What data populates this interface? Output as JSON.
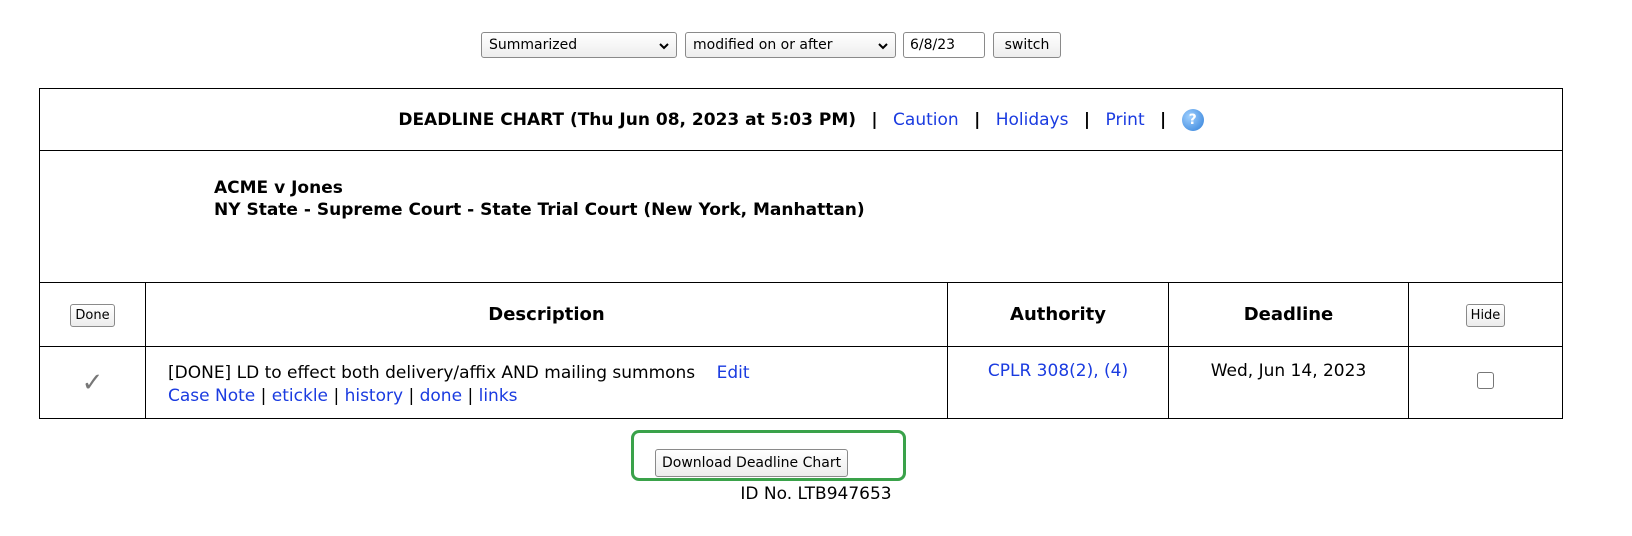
{
  "controls": {
    "view_select": "Summarized",
    "filter_select": "modified on or after",
    "date_value": "6/8/23",
    "switch_label": "switch"
  },
  "header": {
    "title": "DEADLINE CHART (Thu Jun 08, 2023 at 5:03 PM)",
    "caution": "Caution",
    "holidays": "Holidays",
    "print": "Print",
    "separator": "|",
    "help_icon": "?"
  },
  "case": {
    "name": "ACME v Jones",
    "court": "NY State - Supreme Court - State Trial Court (New York, Manhattan)"
  },
  "columns": {
    "done_button": "Done",
    "description": "Description",
    "authority": "Authority",
    "deadline": "Deadline",
    "hide_button": "Hide"
  },
  "rows": [
    {
      "done_mark": "✓",
      "description": "[DONE] LD to effect both delivery/affix AND mailing summons",
      "edit": "Edit",
      "links": {
        "case_note": "Case Note",
        "etickle": "etickle",
        "history": "history",
        "done": "done",
        "links": "links"
      },
      "authority": "CPLR 308(2), (4)",
      "deadline": "Wed, Jun 14, 2023",
      "hidden": false
    }
  ],
  "footer": {
    "download_label": "Download Deadline Chart",
    "id_no": "ID No. LTB947653"
  },
  "colors": {
    "link": "#1a3be0",
    "highlight": "#3aa24a",
    "border": "#000000"
  }
}
